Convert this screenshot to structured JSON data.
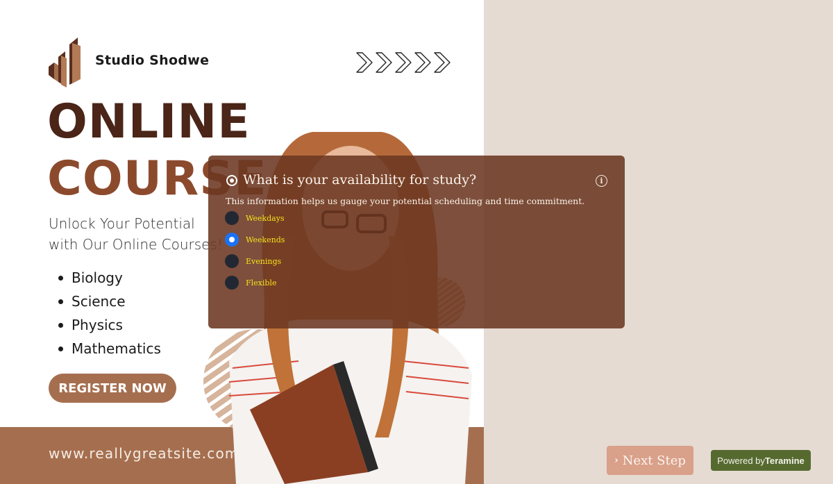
{
  "poster": {
    "brand_name": "Studio Shodwe",
    "title_line_1": "ONLINE",
    "title_line_2": "COURSE",
    "tagline_line_1": "Unlock Your Potential",
    "tagline_line_2": "with Our Online Courses!",
    "subjects": [
      "Biology",
      "Science",
      "Physics",
      "Mathematics"
    ],
    "register_label": "REGISTER NOW",
    "website": "www.reallygreatsite.com",
    "colors": {
      "title_dark": "#4a2518",
      "title_accent": "#8c4a2d",
      "brown_band": "#a56f4f"
    }
  },
  "form": {
    "question": "What is your availability for study?",
    "description": "This information helps us gauge your potential scheduling and time commitment.",
    "info_icon": "info-circle-icon",
    "options": [
      {
        "label": "Weekdays",
        "selected": false
      },
      {
        "label": "Weekends",
        "selected": true
      },
      {
        "label": "Evenings",
        "selected": false
      },
      {
        "label": "Flexible",
        "selected": false
      }
    ],
    "colors": {
      "overlay": "#6b3721",
      "option_text": "#f5e21b",
      "radio_selected": "#1a73f5",
      "radio_unselected": "#222833"
    }
  },
  "footer": {
    "next_label": "Next Step",
    "powered_prefix": "Powered by",
    "powered_brand": "Teramine",
    "colors": {
      "next_button": "#d9a08a",
      "powered_badge": "#566a30"
    }
  }
}
